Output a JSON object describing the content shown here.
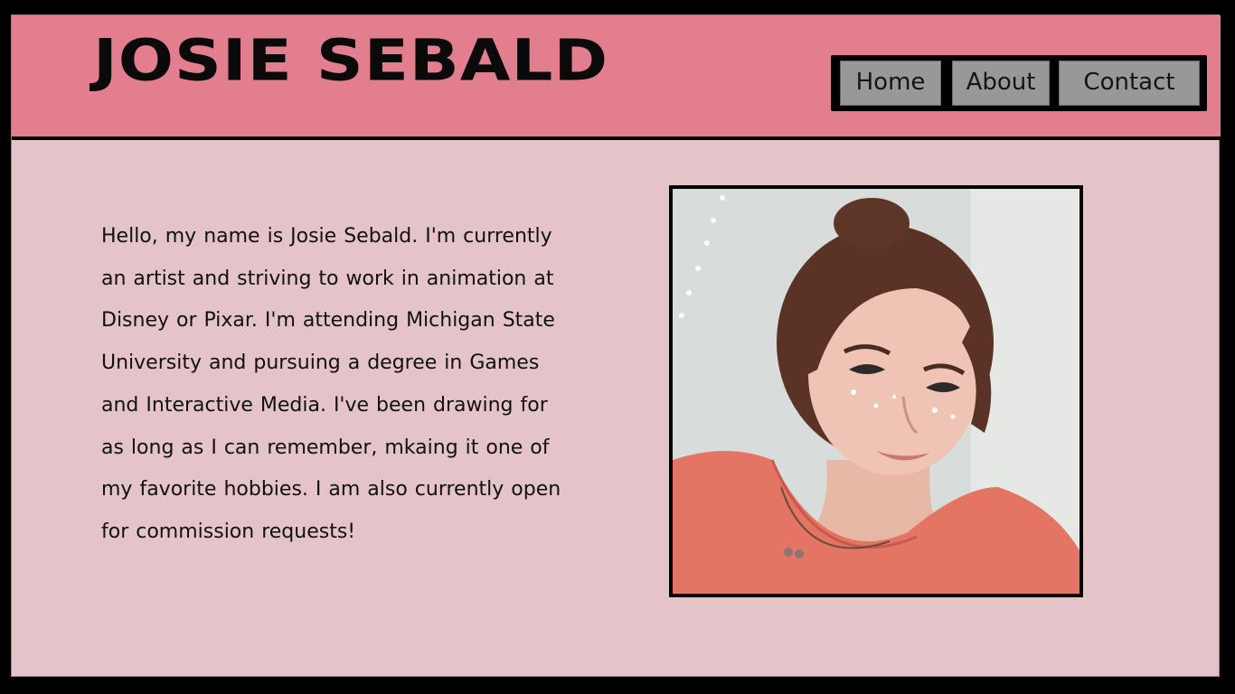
{
  "header": {
    "title": "JOSIE SEBALD"
  },
  "nav": {
    "items": [
      {
        "label": "Home"
      },
      {
        "label": "About"
      },
      {
        "label": "Contact"
      }
    ]
  },
  "main": {
    "bio": "Hello, my name is Josie Sebald. I'm currently an artist and striving to work in animation at Disney or Pixar. I'm attending Michigan State University and pursuing a degree in Games and Interactive Media. I've been drawing for as long as I can remember, mkaing it one of my favorite hobbies. I am also currently open for commission requests!"
  },
  "colors": {
    "header_bg": "#e37e8f",
    "body_bg": "#e4c3c9",
    "nav_button_bg": "#989898",
    "frame_border": "#000000"
  }
}
